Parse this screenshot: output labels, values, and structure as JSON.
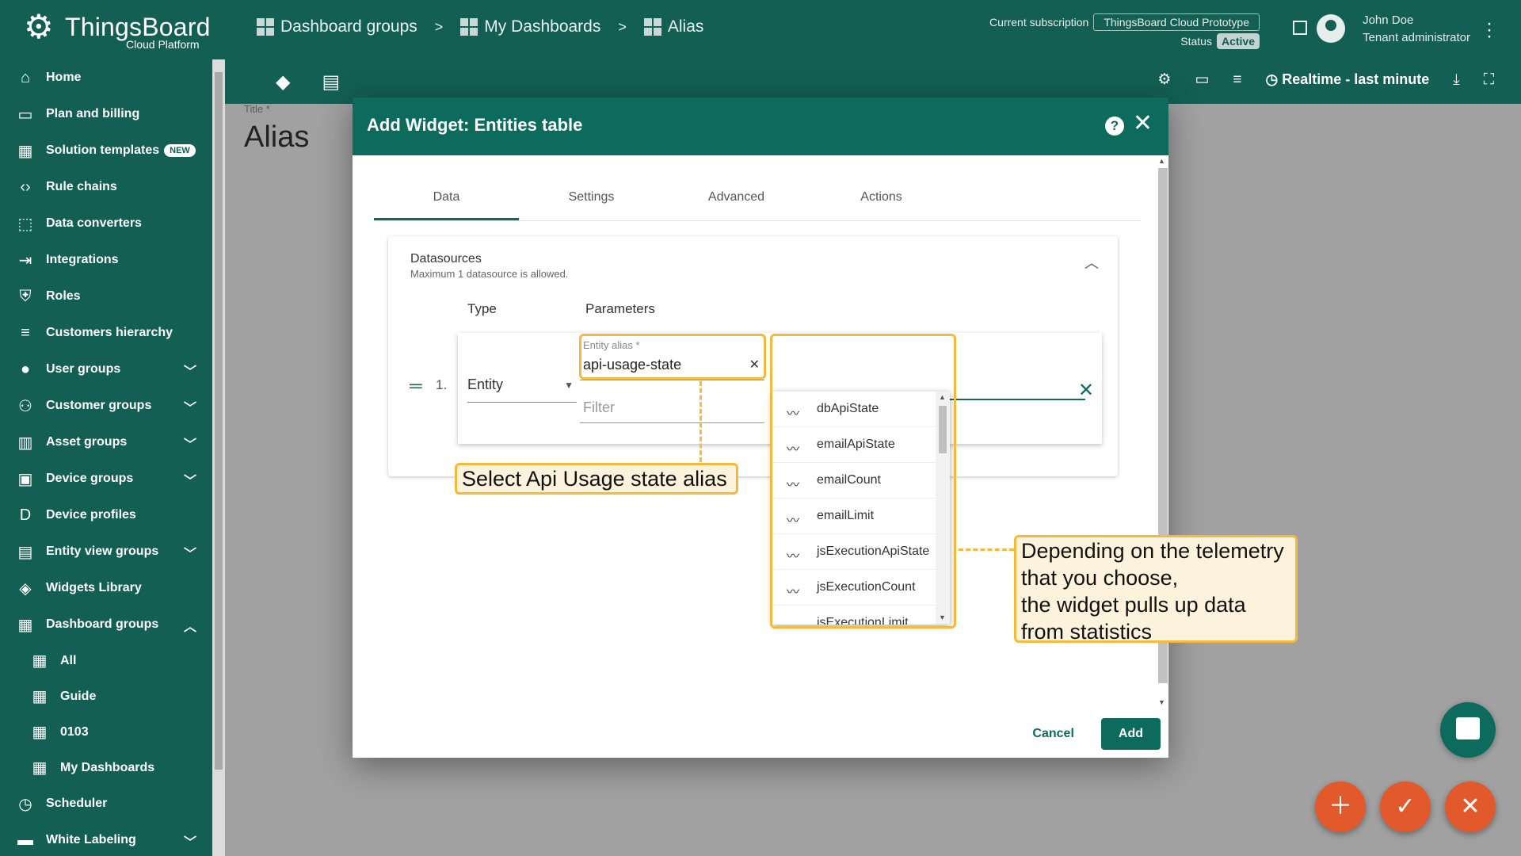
{
  "app": {
    "logo_name": "ThingsBoard",
    "logo_sub": "Cloud Platform"
  },
  "breadcrumbs": [
    "Dashboard groups",
    "My Dashboards",
    "Alias"
  ],
  "breadcrumb_sep": ">",
  "subscription": {
    "label": "Current subscription",
    "value": "ThingsBoard Cloud Prototype",
    "status_label": "Status",
    "status_value": "Active"
  },
  "user": {
    "name": "John Doe",
    "role": "Tenant administrator"
  },
  "sidebar": {
    "items": [
      {
        "label": "Home",
        "icon": "home-icon"
      },
      {
        "label": "Plan and billing",
        "icon": "billing-icon"
      },
      {
        "label": "Solution templates",
        "icon": "apps-icon",
        "badge": "NEW"
      },
      {
        "label": "Rule chains",
        "icon": "code-icon"
      },
      {
        "label": "Data converters",
        "icon": "transform-icon"
      },
      {
        "label": "Integrations",
        "icon": "input-icon"
      },
      {
        "label": "Roles",
        "icon": "shield-icon"
      },
      {
        "label": "Customers hierarchy",
        "icon": "sort-icon"
      },
      {
        "label": "User groups",
        "icon": "account-icon",
        "expandable": true
      },
      {
        "label": "Customer groups",
        "icon": "people-icon",
        "expandable": true
      },
      {
        "label": "Asset groups",
        "icon": "domain-icon",
        "expandable": true
      },
      {
        "label": "Device groups",
        "icon": "devices-icon",
        "expandable": true
      },
      {
        "label": "Device profiles",
        "icon": "profile-icon"
      },
      {
        "label": "Entity view groups",
        "icon": "view-quilt-icon",
        "expandable": true
      },
      {
        "label": "Widgets Library",
        "icon": "widgets-icon"
      },
      {
        "label": "Dashboard groups",
        "icon": "dashboard-icon",
        "expanded": true
      }
    ],
    "children": [
      "All",
      "Guide",
      "0103",
      "My Dashboards"
    ],
    "after": [
      {
        "label": "Scheduler",
        "icon": "schedule-icon"
      },
      {
        "label": "White Labeling",
        "icon": "format-paint-icon",
        "expandable": true
      }
    ]
  },
  "toolbar": {
    "realtime": "Realtime - last minute"
  },
  "dashboard": {
    "title_label": "Title *",
    "title": "Alias"
  },
  "dialog": {
    "title": "Add Widget: Entities table",
    "tabs": [
      "Data",
      "Settings",
      "Advanced",
      "Actions"
    ],
    "datasources_title": "Datasources",
    "datasources_sub": "Maximum 1 datasource is allowed.",
    "col_type": "Type",
    "col_params": "Parameters",
    "row_index": "1.",
    "type_value": "Entity",
    "alias_label": "Entity alias *",
    "alias_value": "api-usage-state",
    "filter_placeholder": "Filter",
    "cancel": "Cancel",
    "add": "Add"
  },
  "dropdown": {
    "items": [
      "dbApiState",
      "emailApiState",
      "emailCount",
      "emailLimit",
      "jsExecutionApiState",
      "jsExecutionCount",
      "jsExecutionLimit"
    ]
  },
  "annotations": {
    "alias_callout": "Select Api Usage state alias",
    "telemetry_callout": [
      "Depending on the telemetry",
      "that you choose,",
      "the widget pulls up data",
      "from statistics"
    ]
  },
  "colors": {
    "primary": "#135f53",
    "dialog_header": "#0d6b5d",
    "highlight": "#f6b93b",
    "fab": "#e25a2b"
  }
}
